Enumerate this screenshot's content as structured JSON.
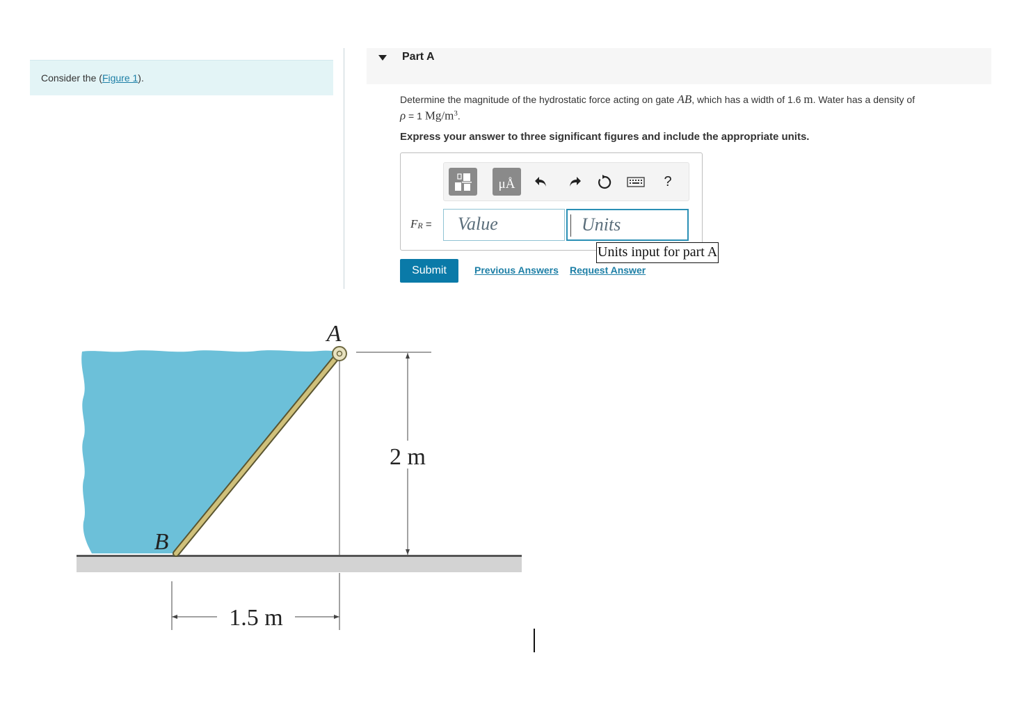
{
  "left_panel": {
    "consider_prefix": "Consider the (",
    "figure_link": "Figure 1",
    "consider_suffix": ")."
  },
  "part": {
    "title": "Part A"
  },
  "question": {
    "text_1": "Determine the magnitude of the hydrostatic force acting on gate ",
    "gate": "AB",
    "text_2": ", which has a width of 1.6 ",
    "unit_m": "m",
    "text_3": ". Water has a density of",
    "rho_symbol": "ρ",
    "rho_eq": " = 1 ",
    "rho_unit": "Mg/m",
    "rho_exp": "3",
    "end": "."
  },
  "instruction": "Express your answer to three significant figures and include the appropriate units.",
  "toolbar": {
    "units_btn_text": "μÅ",
    "help_text": "?",
    "icons": [
      "templates-icon",
      "units-icon",
      "undo-icon",
      "redo-icon",
      "reset-icon",
      "keyboard-icon",
      "help-icon"
    ]
  },
  "answer": {
    "label_main": "F",
    "label_sub": "R",
    "label_eq": " =",
    "value_placeholder": "Value",
    "units_placeholder": "Units",
    "tooltip": "Units input for part A"
  },
  "actions": {
    "submit": "Submit",
    "previous_answers": "Previous Answers",
    "request_answer": "Request Answer"
  },
  "figure": {
    "label_a": "A",
    "label_b": "B",
    "dim_height": "2 m",
    "dim_width": "1.5 m",
    "colors": {
      "water": "#6cc0d9",
      "gate": "#cfc07a",
      "ground": "#c9c9c9"
    }
  }
}
